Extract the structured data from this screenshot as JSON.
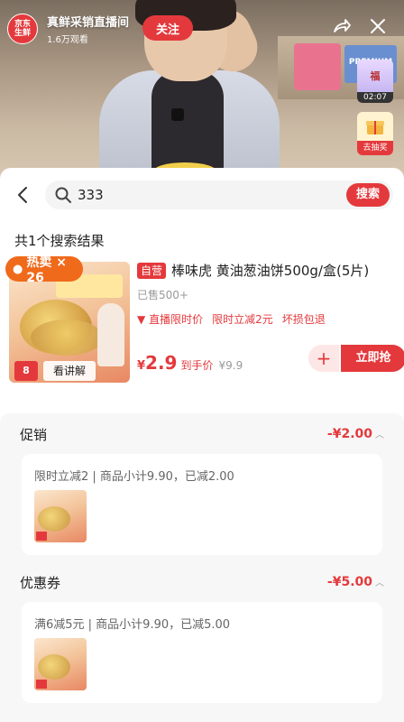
{
  "live": {
    "shop_logo_line1": "京东",
    "shop_logo_line2": "生鲜",
    "shop_name": "真鲜采销直播间",
    "viewers": "1.6万观看",
    "follow_label": "关注",
    "fu_label": "福",
    "fu_timer": "02:07",
    "lottery_label": "去抽奖"
  },
  "search": {
    "query": "333",
    "button_label": "搜索",
    "result_count": "共1个搜索结果"
  },
  "product": {
    "hot_label": "热卖 × 26",
    "explain_label": "看讲解",
    "thumb_number": "8",
    "self_tag": "自营",
    "title": "棒味虎 黄油葱油饼500g/盒(5片)",
    "sold": "已售500+",
    "tag_live": "直播限时价",
    "tag_discount": "限时立减2元",
    "tag_guarantee": "坏损包退",
    "price_symbol": "¥",
    "price": "2.9",
    "price_label": "到手价",
    "original_price": "¥9.9",
    "add_label": "+",
    "buy_label": "立即抢"
  },
  "promotions": [
    {
      "title": "促销",
      "amount": "-¥2.00",
      "desc": "限时立减2 | 商品小计9.90，已减2.00"
    },
    {
      "title": "优惠券",
      "amount": "-¥5.00",
      "desc": "满6减5元 | 商品小计9.90，已减5.00"
    }
  ],
  "colors": {
    "accent": "#e4393c",
    "hot": "#f06a1b"
  },
  "icons": {
    "back": "chevron-left-icon",
    "search": "search-icon",
    "share": "share-icon",
    "close": "close-icon"
  }
}
